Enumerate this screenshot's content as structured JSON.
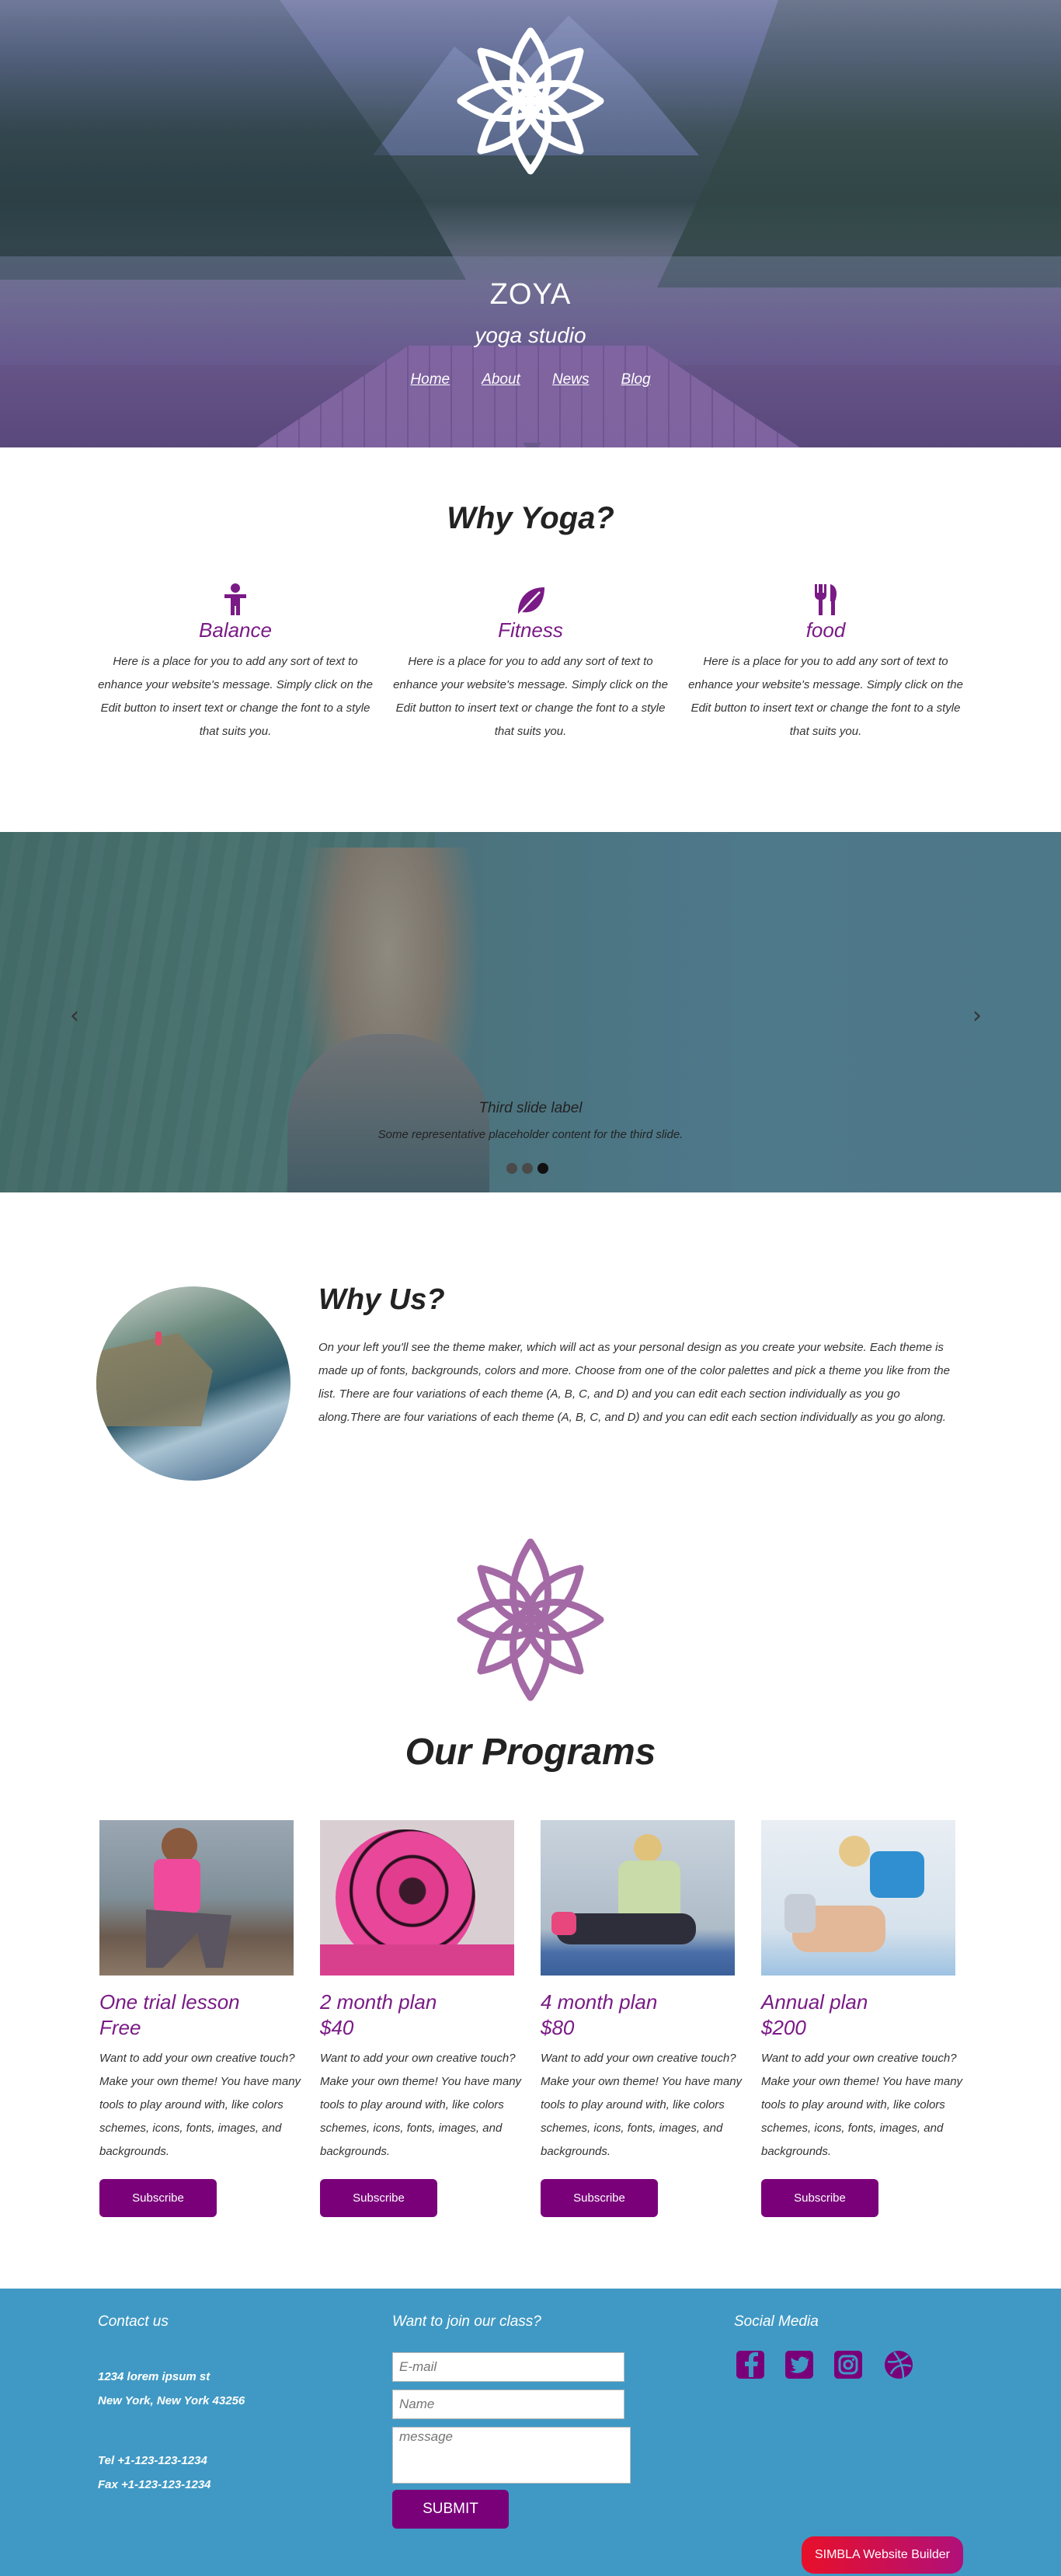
{
  "hero": {
    "brand_name": "ZOYA",
    "tagline": "yoga studio",
    "nav": [
      "Home",
      "About",
      "News",
      "Blog"
    ]
  },
  "why_yoga": {
    "title": "Why Yoga?",
    "features": [
      {
        "icon": "person-icon",
        "title": "Balance",
        "text": "Here is a place for you to add any sort of text to enhance your website's message. Simply click on the Edit button to insert text or change the font to a style that suits you."
      },
      {
        "icon": "leaf-icon",
        "title": "Fitness",
        "text": "Here is a place for you to add any sort of text to enhance your website's message. Simply click on the Edit button to insert text or change the font to a style that suits you."
      },
      {
        "icon": "utensils-icon",
        "title": "food",
        "text": "Here is a place for you to add any sort of text to enhance your website's message. Simply click on the Edit button to insert text or change the font to a style that suits you."
      }
    ]
  },
  "carousel": {
    "slide_label": "Third slide label",
    "slide_caption": "Some representative placeholder content for the third slide.",
    "prev_icon": "chevron-left-icon",
    "next_icon": "chevron-right-icon",
    "slide_count": 3,
    "active_slide": 3
  },
  "why_us": {
    "title": "Why Us?",
    "text": "On your left you'll see the theme maker, which will act as your personal design as you create your website. Each theme is made up of fonts, backgrounds, colors and more. Choose from one of the color palettes and pick a theme you like from the list. There are four variations of each theme (A, B, C, and D) and you can edit each section individually as you go along.There are four variations of each theme (A, B, C, and D) and you can edit each section individually as you go along."
  },
  "programs": {
    "title": "Our Programs",
    "items": [
      {
        "title": "One trial lesson",
        "price": "Free",
        "text": "Want to add your own creative touch? Make your own theme! You have many tools to play around with, like colors schemes, icons, fonts, images, and backgrounds.",
        "button": "Subscribe"
      },
      {
        "title": "2 month plan",
        "price": "$40",
        "text": "Want to add your own creative touch? Make your own theme! You have many tools to play around with, like colors schemes, icons, fonts, images, and backgrounds.",
        "button": "Subscribe"
      },
      {
        "title": "4 month plan",
        "price": "$80",
        "text": "Want to add your own creative touch? Make your own theme! You have many tools to play around with, like colors schemes, icons, fonts, images, and backgrounds.",
        "button": "Subscribe"
      },
      {
        "title": "Annual plan",
        "price": "$200",
        "text": "Want to add your own creative touch? Make your own theme! You have many tools to play around with, like colors schemes, icons, fonts, images, and backgrounds.",
        "button": "Subscribe"
      }
    ]
  },
  "footer": {
    "contact_title": "Contact us",
    "address_line1": "1234 lorem ipsum st",
    "address_line2": "New York, New York 43256",
    "tel": "Tel +1-123-123-1234",
    "fax": "Fax +1-123-123-1234",
    "join_title": "Want to join our class?",
    "email_placeholder": "E-mail",
    "name_placeholder": "Name",
    "message_placeholder": "message",
    "submit_label": "SUBMIT",
    "social_title": "Social Media",
    "social_icons": [
      "facebook-icon",
      "twitter-icon",
      "instagram-icon",
      "dribbble-icon"
    ]
  },
  "badge": {
    "label": "SIMBLA Website Builder"
  },
  "colors": {
    "accent": "#7a007a",
    "footer_bg": "#4099c4",
    "feature_title": "#7a1a86",
    "badge": "#e8102a"
  }
}
